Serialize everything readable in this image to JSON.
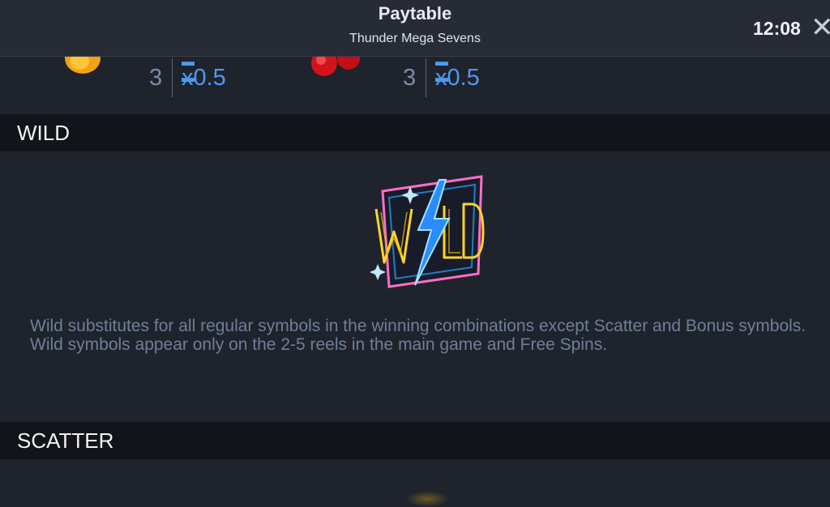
{
  "header": {
    "title": "Paytable",
    "subtitle": "Thunder Mega Sevens",
    "clock": "12:08",
    "close_glyph": "✕"
  },
  "paytable_row": {
    "items": [
      {
        "symbol": "orange-icon",
        "count": "3",
        "multiplier": "x0.5"
      },
      {
        "symbol": "cherry-icon",
        "count": "3",
        "multiplier": "x0.5"
      }
    ]
  },
  "wild": {
    "heading": "WILD",
    "icon": "wild-lightning-icon",
    "description_line1": "Wild substitutes for all regular symbols in the winning combinations except Scatter and Bonus symbols.",
    "description_line2": "Wild symbols appear only on the 2-5 reels in the main game and Free Spins."
  },
  "scatter": {
    "heading": "SCATTER"
  },
  "colors": {
    "background": "#1f232c",
    "header_bar": "#262b36",
    "section_header": "#121419",
    "multiplier_blue": "#4d9af0",
    "count_gray": "#7b8ca8",
    "description_gray": "#6f7f99"
  }
}
